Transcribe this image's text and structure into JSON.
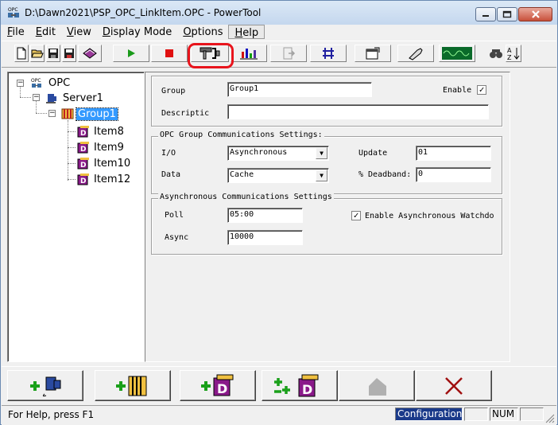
{
  "window": {
    "title": "D:\\Dawn2021\\PSP_OPC_LinkItem.OPC - PowerTool",
    "icon": "opc-app-icon",
    "buttons": [
      "minimize-icon",
      "maximize-icon",
      "close-icon"
    ]
  },
  "menu": {
    "items": [
      {
        "label": "File",
        "mnemonic": "F",
        "rest": "ile"
      },
      {
        "label": "Edit",
        "mnemonic": "E",
        "rest": "dit"
      },
      {
        "label": "View",
        "mnemonic": "V",
        "rest": "iew"
      },
      {
        "label": "Display Mode",
        "mnemonic": "D",
        "rest": "isplay Mode"
      },
      {
        "label": "Options",
        "mnemonic": "O",
        "rest": "ptions"
      },
      {
        "label": "Help",
        "mnemonic": "H",
        "rest": "elp"
      }
    ]
  },
  "toolbar": {
    "icons": [
      "new-icon",
      "open-icon",
      "save-icon",
      "save-as-icon",
      "settings-book-icon",
      "run-icon",
      "stop-icon",
      "configure-tools-icon",
      "chart-icon",
      "export-icon",
      "network-icon",
      "properties-icon",
      "tool-icon",
      "waveform-icon",
      "find-icon",
      "sort-icon"
    ],
    "highlight_color": "#e8141c"
  },
  "tree": {
    "root": "OPC",
    "server": "Server1",
    "group": "Group1",
    "items": [
      "Item8",
      "Item9",
      "Item10",
      "Item12"
    ],
    "selection_color": "#3399ff"
  },
  "group_form": {
    "group_label": "Group",
    "group_value": "Group1",
    "enable_label": "Enable",
    "enable_checked": true,
    "description_label": "Descriptic",
    "description_value": ""
  },
  "comm_settings": {
    "title": "OPC Group Communications Settings:",
    "io_label": "I/O",
    "io_value": "Asynchronous",
    "data_label": "Data",
    "data_value": "Cache",
    "update_label": "Update",
    "update_value": "01",
    "deadband_label": "% Deadband:",
    "deadband_value": "0"
  },
  "async_settings": {
    "title": "Asynchronous Communications Settings",
    "poll_label": "Poll",
    "poll_value": "05:00",
    "async_label": "Async",
    "async_value": "10000",
    "watchdog_label": "Enable Asynchronous Watchdo",
    "watchdog_checked": true
  },
  "bottom_buttons": [
    "add-server-icon",
    "add-group-icon",
    "add-item-icon",
    "add-multiple-items-icon",
    "disabled-icon",
    "delete-icon"
  ],
  "status": {
    "help": "For Help, press F1",
    "mode": "Configuration",
    "num": "NUM"
  }
}
